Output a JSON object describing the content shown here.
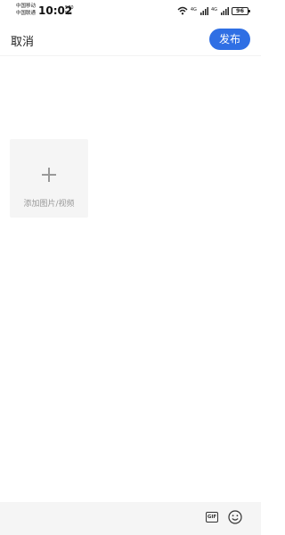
{
  "status_bar": {
    "carrier_1": "中国移动",
    "carrier_2": "中国联通",
    "time": "10:02",
    "net_speed_value": "570",
    "net_speed_unit": "B/s",
    "sim1_label": "4G",
    "sim2_label": "4G",
    "battery": "96"
  },
  "header": {
    "cancel_label": "取消",
    "publish_label": "发布"
  },
  "composer": {
    "text_value": "",
    "add_media_label": "添加图片/视频"
  },
  "toolbar": {
    "gif_label": "GIF"
  },
  "colors": {
    "accent": "#2f6fe4",
    "toolbar_bg": "#f5f5f5",
    "tile_bg": "#f5f5f5"
  }
}
